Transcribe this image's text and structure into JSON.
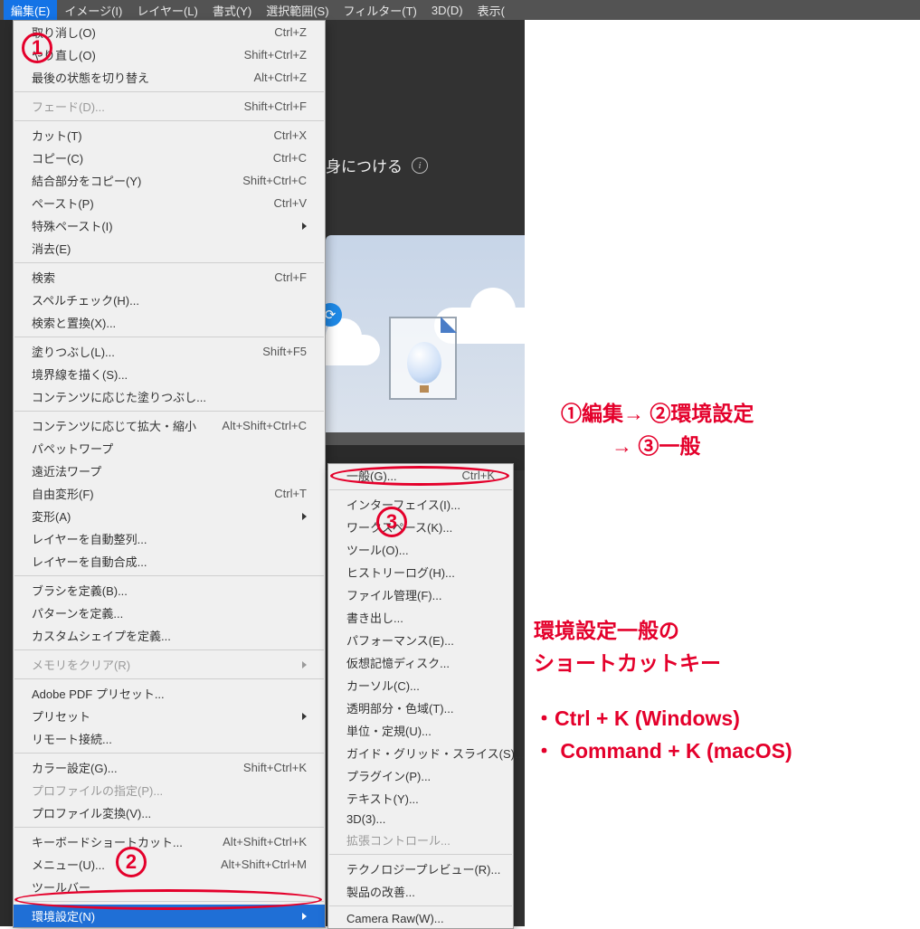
{
  "menubar": {
    "items": [
      {
        "label": "編集(E)"
      },
      {
        "label": "イメージ(I)"
      },
      {
        "label": "レイヤー(L)"
      },
      {
        "label": "書式(Y)"
      },
      {
        "label": "選択範囲(S)"
      },
      {
        "label": "フィルター(T)"
      },
      {
        "label": "3D(D)"
      },
      {
        "label": "表示("
      }
    ]
  },
  "banner": {
    "text": "身につける",
    "info_glyph": "i"
  },
  "refresh_glyph": "⟳",
  "edit_menu": [
    {
      "type": "item",
      "label": "取り消し(O)",
      "shortcut": "Ctrl+Z"
    },
    {
      "type": "item",
      "label": "やり直し(O)",
      "shortcut": "Shift+Ctrl+Z"
    },
    {
      "type": "item",
      "label": "最後の状態を切り替え",
      "shortcut": "Alt+Ctrl+Z"
    },
    {
      "type": "sep"
    },
    {
      "type": "item",
      "label": "フェード(D)...",
      "shortcut": "Shift+Ctrl+F",
      "disabled": true
    },
    {
      "type": "sep"
    },
    {
      "type": "item",
      "label": "カット(T)",
      "shortcut": "Ctrl+X"
    },
    {
      "type": "item",
      "label": "コピー(C)",
      "shortcut": "Ctrl+C"
    },
    {
      "type": "item",
      "label": "結合部分をコピー(Y)",
      "shortcut": "Shift+Ctrl+C"
    },
    {
      "type": "item",
      "label": "ペースト(P)",
      "shortcut": "Ctrl+V"
    },
    {
      "type": "item",
      "label": "特殊ペースト(I)",
      "shortcut": "",
      "arrow": true
    },
    {
      "type": "item",
      "label": "消去(E)",
      "shortcut": ""
    },
    {
      "type": "sep"
    },
    {
      "type": "item",
      "label": "検索",
      "shortcut": "Ctrl+F"
    },
    {
      "type": "item",
      "label": "スペルチェック(H)...",
      "shortcut": ""
    },
    {
      "type": "item",
      "label": "検索と置換(X)...",
      "shortcut": ""
    },
    {
      "type": "sep"
    },
    {
      "type": "item",
      "label": "塗りつぶし(L)...",
      "shortcut": "Shift+F5"
    },
    {
      "type": "item",
      "label": "境界線を描く(S)...",
      "shortcut": ""
    },
    {
      "type": "item",
      "label": "コンテンツに応じた塗りつぶし...",
      "shortcut": ""
    },
    {
      "type": "sep"
    },
    {
      "type": "item",
      "label": "コンテンツに応じて拡大・縮小",
      "shortcut": "Alt+Shift+Ctrl+C"
    },
    {
      "type": "item",
      "label": "パペットワープ",
      "shortcut": ""
    },
    {
      "type": "item",
      "label": "遠近法ワープ",
      "shortcut": ""
    },
    {
      "type": "item",
      "label": "自由変形(F)",
      "shortcut": "Ctrl+T"
    },
    {
      "type": "item",
      "label": "変形(A)",
      "shortcut": "",
      "arrow": true
    },
    {
      "type": "item",
      "label": "レイヤーを自動整列...",
      "shortcut": ""
    },
    {
      "type": "item",
      "label": "レイヤーを自動合成...",
      "shortcut": ""
    },
    {
      "type": "sep"
    },
    {
      "type": "item",
      "label": "ブラシを定義(B)...",
      "shortcut": ""
    },
    {
      "type": "item",
      "label": "パターンを定義...",
      "shortcut": ""
    },
    {
      "type": "item",
      "label": "カスタムシェイプを定義...",
      "shortcut": ""
    },
    {
      "type": "sep"
    },
    {
      "type": "item",
      "label": "メモリをクリア(R)",
      "shortcut": "",
      "arrow": true,
      "disabled": true
    },
    {
      "type": "sep"
    },
    {
      "type": "item",
      "label": "Adobe PDF プリセット...",
      "shortcut": ""
    },
    {
      "type": "item",
      "label": "プリセット",
      "shortcut": "",
      "arrow": true
    },
    {
      "type": "item",
      "label": "リモート接続...",
      "shortcut": ""
    },
    {
      "type": "sep"
    },
    {
      "type": "item",
      "label": "カラー設定(G)...",
      "shortcut": "Shift+Ctrl+K"
    },
    {
      "type": "item",
      "label": "プロファイルの指定(P)...",
      "shortcut": "",
      "disabled": true
    },
    {
      "type": "item",
      "label": "プロファイル変換(V)...",
      "shortcut": ""
    },
    {
      "type": "sep"
    },
    {
      "type": "item",
      "label": "キーボードショートカット...",
      "shortcut": "Alt+Shift+Ctrl+K"
    },
    {
      "type": "item",
      "label": "メニュー(U)...",
      "shortcut": "Alt+Shift+Ctrl+M"
    },
    {
      "type": "item",
      "label": "ツールバー...",
      "shortcut": ""
    },
    {
      "type": "sep"
    },
    {
      "type": "item",
      "label": "環境設定(N)",
      "shortcut": "",
      "arrow": true,
      "highlight": true
    }
  ],
  "prefs_submenu": [
    {
      "type": "item",
      "label": "一般(G)...",
      "shortcut": "Ctrl+K"
    },
    {
      "type": "sep"
    },
    {
      "type": "item",
      "label": "インターフェイス(I)...",
      "shortcut": ""
    },
    {
      "type": "item",
      "label": "ワークスペース(K)...",
      "shortcut": ""
    },
    {
      "type": "item",
      "label": "ツール(O)...",
      "shortcut": ""
    },
    {
      "type": "item",
      "label": "ヒストリーログ(H)...",
      "shortcut": ""
    },
    {
      "type": "item",
      "label": "ファイル管理(F)...",
      "shortcut": ""
    },
    {
      "type": "item",
      "label": "書き出し...",
      "shortcut": ""
    },
    {
      "type": "item",
      "label": "パフォーマンス(E)...",
      "shortcut": ""
    },
    {
      "type": "item",
      "label": "仮想記憶ディスク...",
      "shortcut": ""
    },
    {
      "type": "item",
      "label": "カーソル(C)...",
      "shortcut": ""
    },
    {
      "type": "item",
      "label": "透明部分・色域(T)...",
      "shortcut": ""
    },
    {
      "type": "item",
      "label": "単位・定規(U)...",
      "shortcut": ""
    },
    {
      "type": "item",
      "label": "ガイド・グリッド・スライス(S)...",
      "shortcut": ""
    },
    {
      "type": "item",
      "label": "プラグイン(P)...",
      "shortcut": ""
    },
    {
      "type": "item",
      "label": "テキスト(Y)...",
      "shortcut": ""
    },
    {
      "type": "item",
      "label": "3D(3)...",
      "shortcut": ""
    },
    {
      "type": "item",
      "label": "拡張コントロール...",
      "shortcut": "",
      "disabled": true
    },
    {
      "type": "sep"
    },
    {
      "type": "item",
      "label": "テクノロジープレビュー(R)...",
      "shortcut": ""
    },
    {
      "type": "item",
      "label": "製品の改善...",
      "shortcut": ""
    },
    {
      "type": "sep"
    },
    {
      "type": "item",
      "label": "Camera Raw(W)...",
      "shortcut": ""
    }
  ],
  "callouts": {
    "n1": "1",
    "n2": "2",
    "n3": "3",
    "path_line1": "①編集→ ②環境設定",
    "path_line2": "→ ③一般",
    "shortcut_title1": "環境設定一般の",
    "shortcut_title2": "ショートカットキー",
    "shortcut_win": "Ctrl + K (Windows)",
    "shortcut_mac": " Command + K (macOS)"
  }
}
